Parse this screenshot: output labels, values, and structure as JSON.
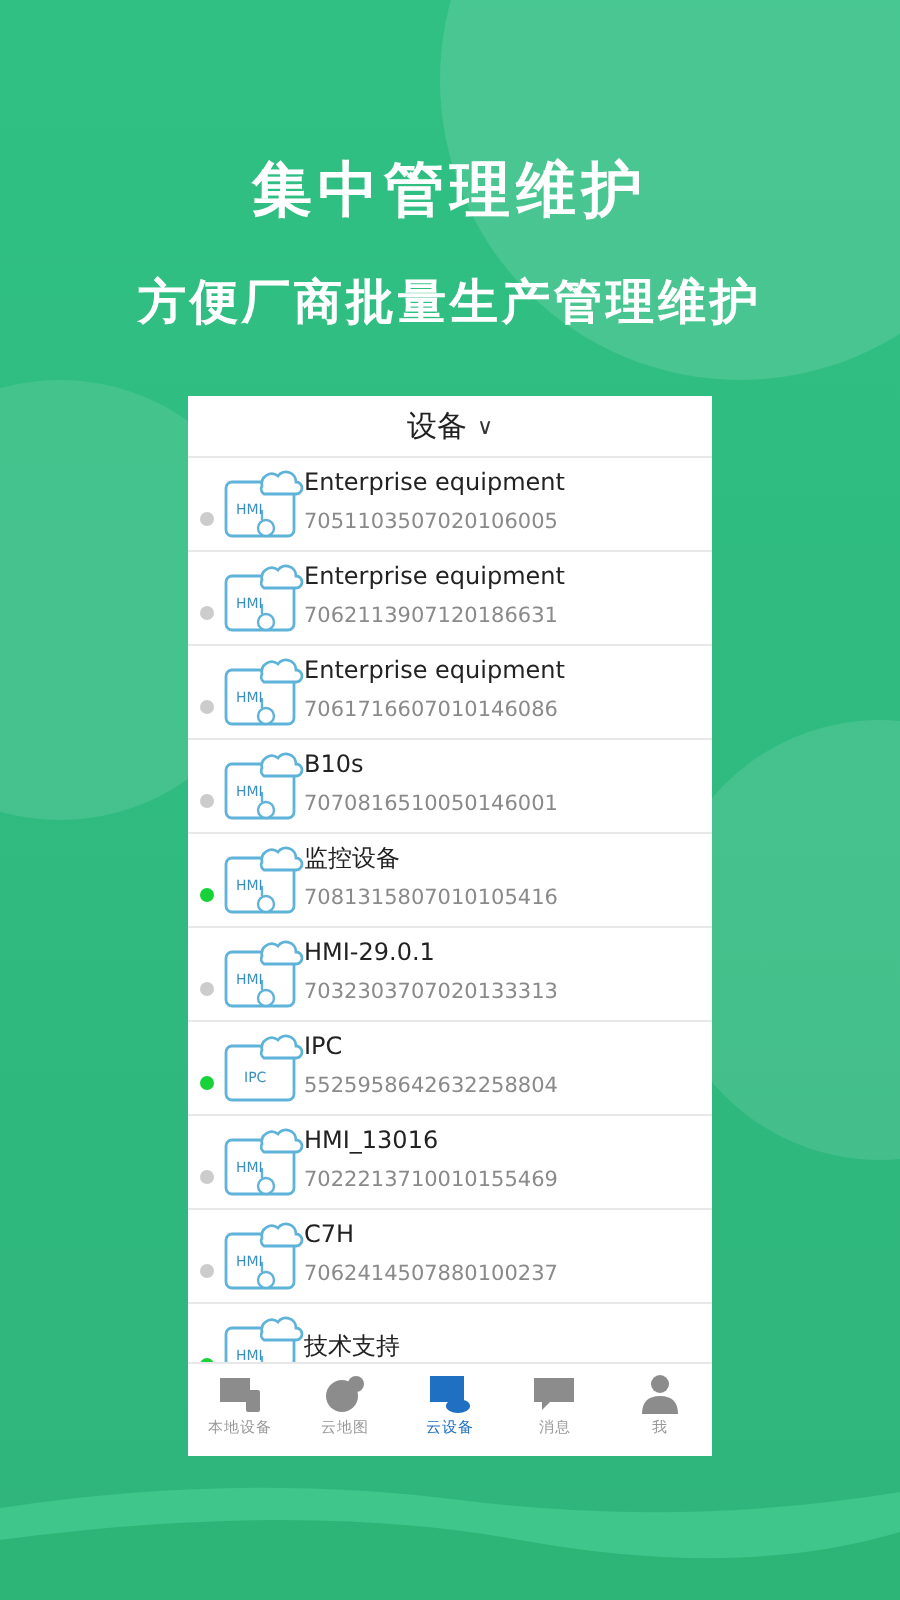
{
  "headline": "集中管理维护",
  "subheadline": "方便厂商批量生产管理维护",
  "header": {
    "title": "设备",
    "caret": "∨"
  },
  "devices": [
    {
      "kind": "hmi",
      "icon_label": "HMI",
      "name": "Enterprise equipment",
      "id": "7051103507020106005",
      "online": false
    },
    {
      "kind": "hmi",
      "icon_label": "HMI",
      "name": "Enterprise equipment",
      "id": "7062113907120186631",
      "online": false
    },
    {
      "kind": "hmi",
      "icon_label": "HMI",
      "name": "Enterprise equipment",
      "id": "7061716607010146086",
      "online": false
    },
    {
      "kind": "hmi",
      "icon_label": "HMI",
      "name": "B10s",
      "id": "7070816510050146001",
      "online": false
    },
    {
      "kind": "hmi",
      "icon_label": "HMI",
      "name": "监控设备",
      "id": "7081315807010105416",
      "online": true
    },
    {
      "kind": "hmi",
      "icon_label": "HMI",
      "name": "HMI-29.0.1",
      "id": "7032303707020133313",
      "online": false
    },
    {
      "kind": "ipc",
      "icon_label": "IPC",
      "name": "IPC",
      "id": "5525958642632258804",
      "online": true
    },
    {
      "kind": "hmi",
      "icon_label": "HMI",
      "name": "HMI_13016",
      "id": "7022213710010155469",
      "online": false
    },
    {
      "kind": "hmi",
      "icon_label": "HMI",
      "name": "C7H",
      "id": "7062414507880100237",
      "online": false
    },
    {
      "kind": "hmi",
      "icon_label": "HMI",
      "name": "技术支持",
      "online": true
    }
  ],
  "tabs": [
    {
      "kind": "local",
      "label": "本地设备",
      "selected": false
    },
    {
      "kind": "map",
      "label": "云地图",
      "selected": false
    },
    {
      "kind": "cloud",
      "label": "云设备",
      "selected": true
    },
    {
      "kind": "message",
      "label": "消息",
      "selected": false
    },
    {
      "kind": "me",
      "label": "我",
      "selected": false
    }
  ]
}
